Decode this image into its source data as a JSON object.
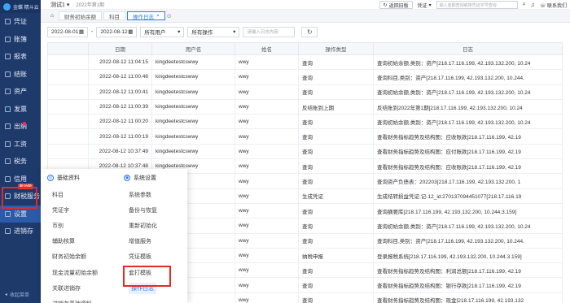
{
  "sidebar": {
    "logo_text": "金蝶 精斗云",
    "items": [
      {
        "label": "凭证"
      },
      {
        "label": "账簿"
      },
      {
        "label": "报表"
      },
      {
        "label": "结账"
      },
      {
        "label": "资产"
      },
      {
        "label": "发票"
      },
      {
        "label": "出纳"
      },
      {
        "label": "工资"
      },
      {
        "label": "税务"
      },
      {
        "label": "信用"
      },
      {
        "label": "财税服务"
      },
      {
        "label": "设置"
      },
      {
        "label": "进销存"
      }
    ],
    "new_badge": "新功能",
    "collapse_label": "收起菜单"
  },
  "topbar": {
    "account_name": "测试1",
    "period": "2022年第1期",
    "back_button": "返回旧版",
    "voucher_select": "凭证",
    "search_placeholder": "输入金额查询或按凭证字号查询",
    "contact": "联系我们"
  },
  "tabs": [
    {
      "label": "财务初始余额"
    },
    {
      "label": "科目"
    },
    {
      "label": "操作日志"
    }
  ],
  "filters": {
    "date_from": "2022-08-01",
    "date_to": "2022-08-12",
    "user_select": "所有用户",
    "op_select": "所有操作",
    "search_placeholder": "请输入日志内容"
  },
  "table": {
    "headers": [
      "日期",
      "用户名",
      "姓名",
      "操作类型",
      "日志"
    ],
    "rows": [
      [
        "2022-08-12 11:04:15",
        "kingdeetestcswwy",
        "wwy",
        "查询",
        "查询初始余额,类别：资产[218.17.116.199, 42.193.132.200, 10.24"
      ],
      [
        "2022-08-12 11:00:46",
        "kingdeetestcswwy",
        "wwy",
        "查询",
        "查询科目,类别：资产[218.17.116.199, 42.193.132.200, 10.244."
      ],
      [
        "2022-08-12 11:00:41",
        "kingdeetestcswwy",
        "wwy",
        "查询",
        "查询初始余额,类别：资产[218.17.116.199, 42.193.132.200, 10.24"
      ],
      [
        "2022-08-12 11:00:39",
        "kingdeetestcswwy",
        "wwy",
        "反结账到上期",
        "反结账到2022年第1期[218.17.116.199, 42.193.132.200, 10.24"
      ],
      [
        "2022-08-12 11:00:20",
        "kingdeetestcswwy",
        "wwy",
        "查询",
        "查询初始余额,类别：资产[218.17.116.199, 42.193.132.200, 10.24"
      ],
      [
        "2022-08-12 11:00:19",
        "kingdeetestcswwy",
        "wwy",
        "查询",
        "查看财务指标趋势及结构图：应收账款[218.17.116.199, 42.19"
      ],
      [
        "2022-08-12 10:37:49",
        "kingdeetestcswwy",
        "wwy",
        "查询",
        "查看财务指标趋势及结构图：应付账款[218.17.116.199, 42.19"
      ],
      [
        "2022-08-12 10:37:48",
        "kingdeetestcswwy",
        "wwy",
        "查询",
        "查看财务指标趋势及结构图：应收账款[218.17.116.199, 42.19"
      ],
      [
        "",
        "",
        "wwy",
        "查询",
        "查询资产负债表：202203[218.17.116.199, 42.193.132.200, 1"
      ],
      [
        "",
        "",
        "wwy",
        "生成凭证",
        "生成结转损益凭证:记-12_id:2701370944510​77[218.17.116.19"
      ],
      [
        "",
        "",
        "wwy",
        "查询",
        "查询摘要库[218.17.116.199, 42.193.132.200, 10.244.3.159]"
      ],
      [
        "",
        "",
        "wwy",
        "查询",
        "查询初始余额,类别：资产[218.17.116.199, 42.193.132.200, 10.24"
      ],
      [
        "",
        "",
        "wwy",
        "查询",
        "查询科目,类别：资产[218.17.116.199, 42.193.132.200, 10.244."
      ],
      [
        "",
        "",
        "wwy",
        "纳税申报",
        "登录报税系统[218.17.116.199, 42.193.132.200, 10.244.3.159]"
      ],
      [
        "",
        "",
        "wwy",
        "查询",
        "查看财务指标趋势及结构图：利润总额[218.17.116.199, 42.19"
      ],
      [
        "",
        "",
        "wwy",
        "查询",
        "查看财务指标趋势及结构图：银行存款[218.17.116.199, 42.19"
      ],
      [
        "",
        "",
        "wwy",
        "查询",
        "查看财务指标趋势及结构图：现金[218.17.116.199, 42.193.132"
      ]
    ]
  },
  "settings_panel": {
    "basic_title": "基础资料",
    "basic_items": [
      "科目",
      "凭证字",
      "币别",
      "辅助核算",
      "财务初始余额",
      "现金流量初始余额",
      "关联进销存",
      "进销存基础资料"
    ],
    "system_title": "系统设置",
    "system_items": [
      "系统参数",
      "备份与恢复",
      "重新初始化",
      "增值服务",
      "凭证模板",
      "套打模板",
      "操作日志"
    ]
  }
}
